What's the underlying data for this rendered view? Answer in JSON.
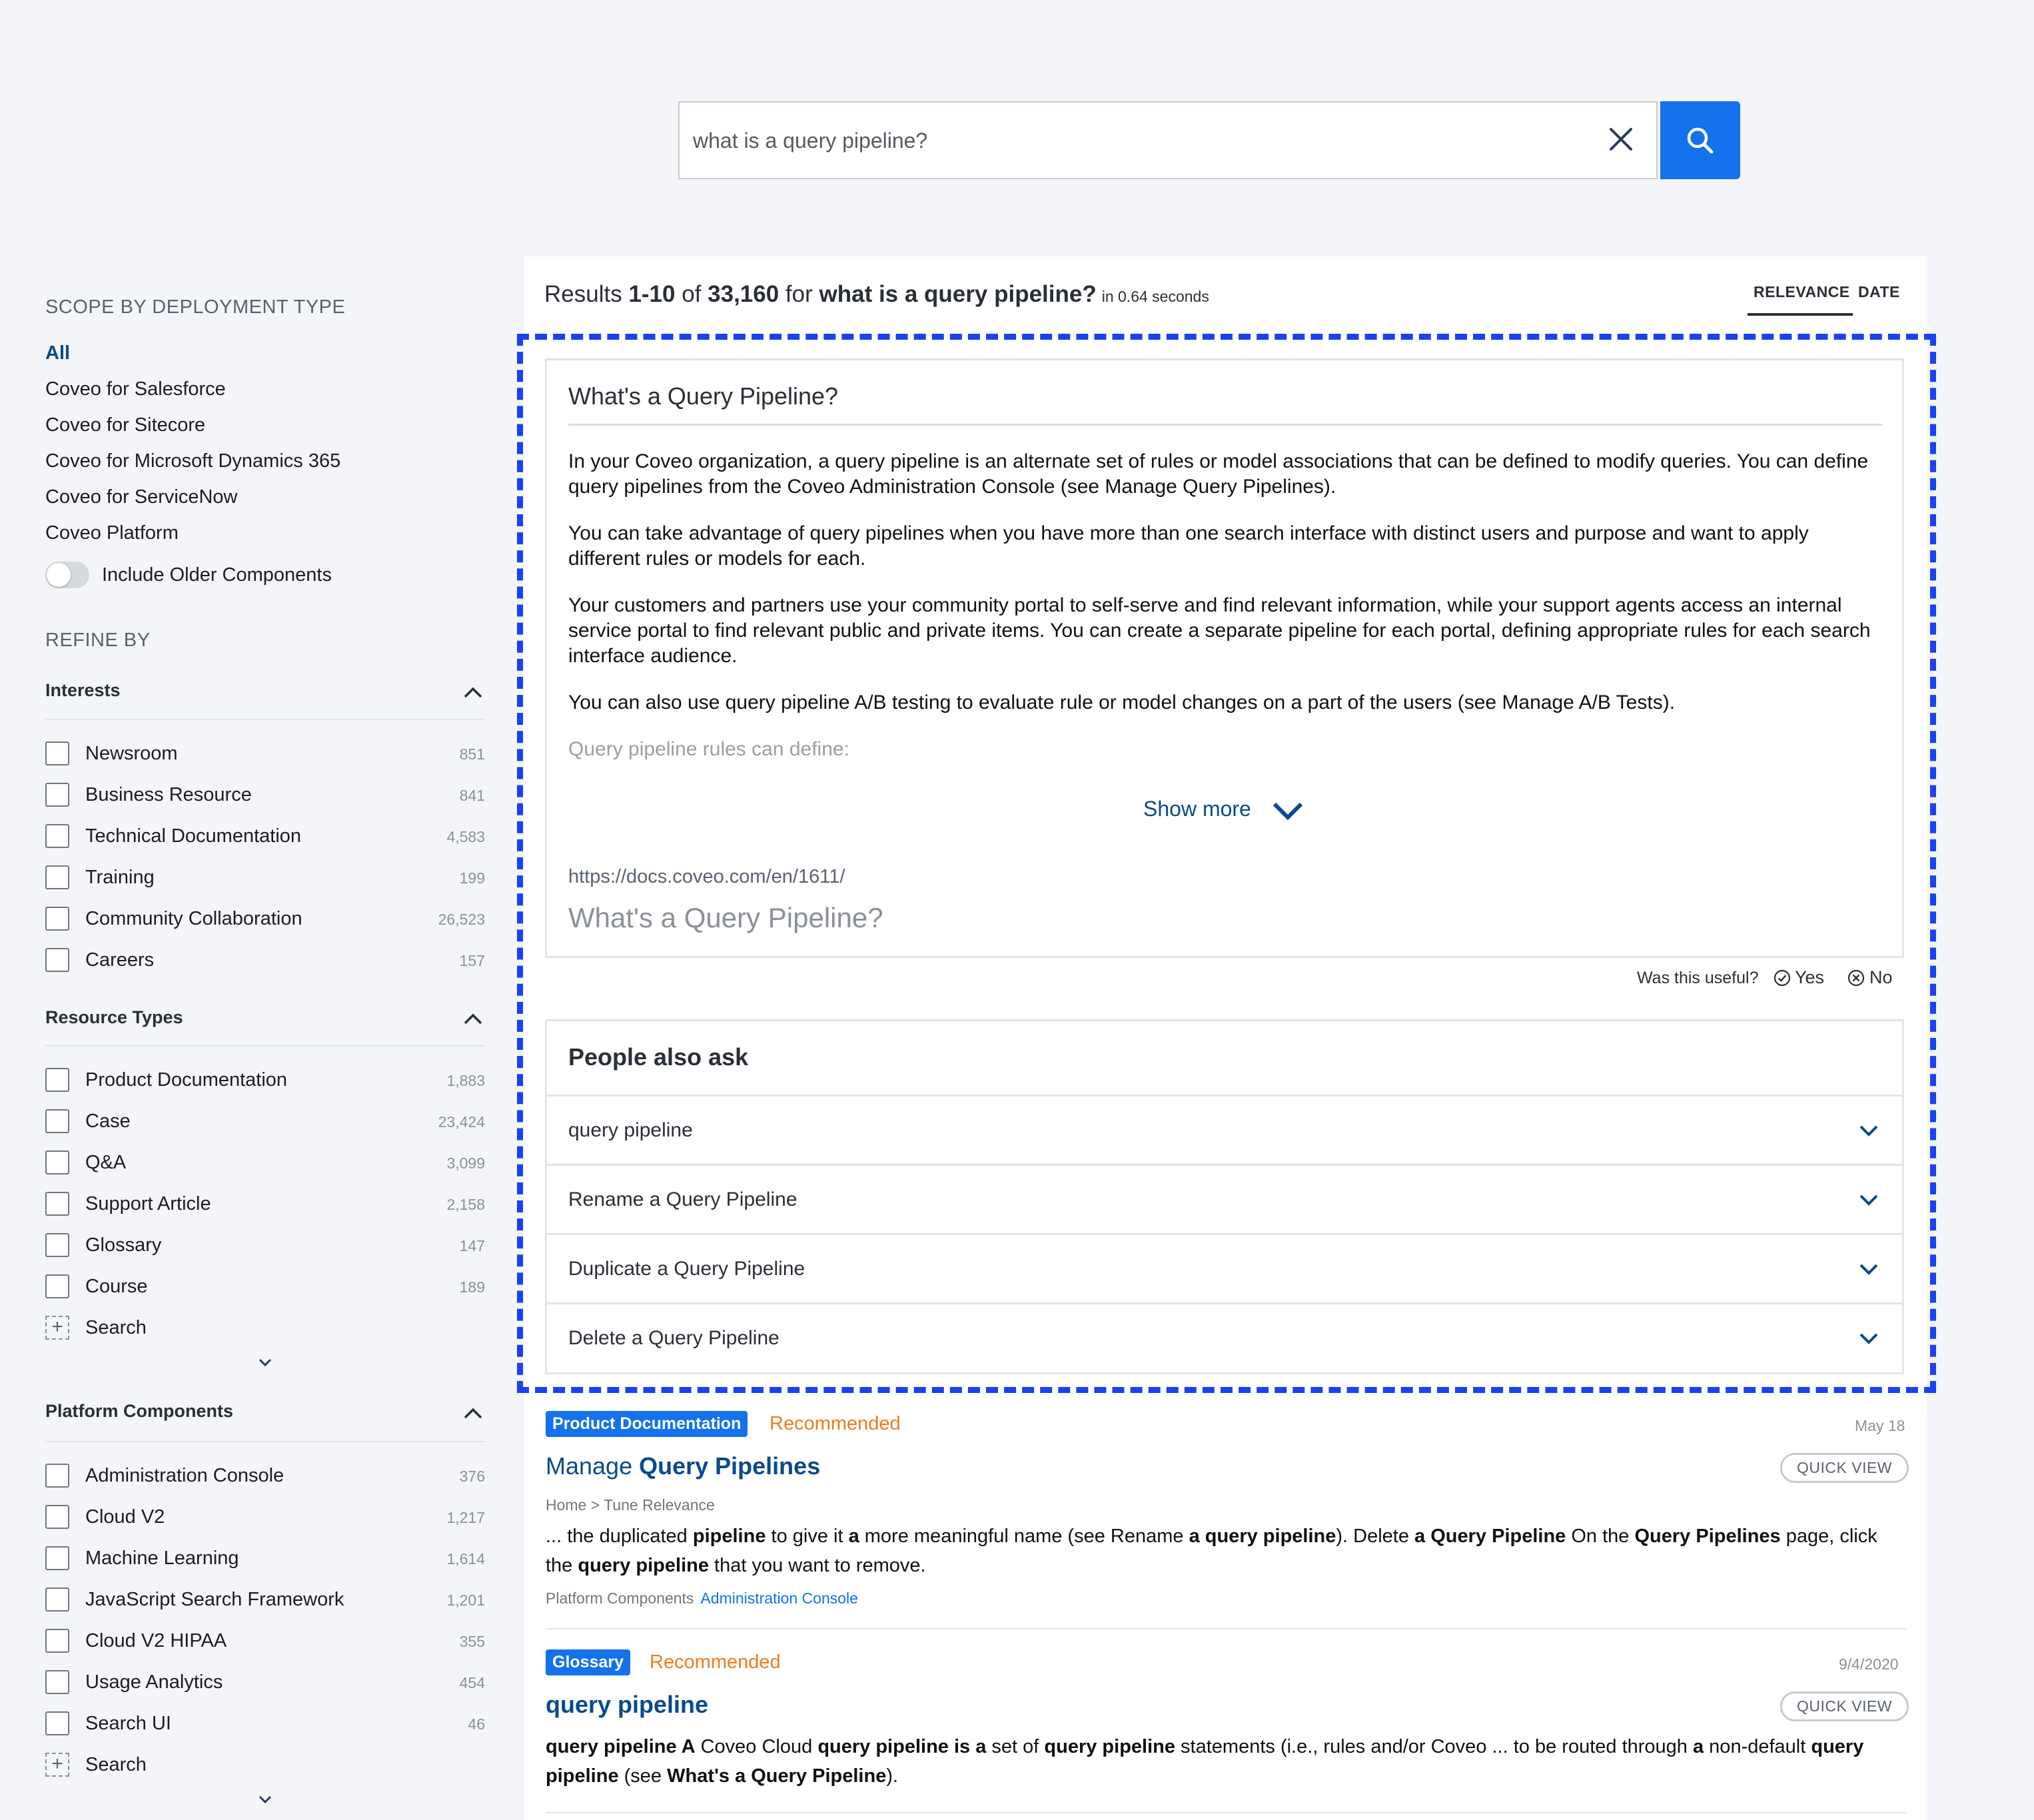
{
  "search": {
    "value": "what is a query pipeline?",
    "placeholder": ""
  },
  "sidebar": {
    "scope_title": "SCOPE BY DEPLOYMENT TYPE",
    "scope_items": [
      "All",
      "Coveo for Salesforce",
      "Coveo for Sitecore",
      "Coveo for Microsoft Dynamics 365",
      "Coveo for ServiceNow",
      "Coveo Platform"
    ],
    "toggle_label": "Include Older Components",
    "refine_title": "REFINE BY",
    "facets": [
      {
        "title": "Interests",
        "values": [
          {
            "label": "Newsroom",
            "count": "851"
          },
          {
            "label": "Business Resource",
            "count": "841"
          },
          {
            "label": "Technical Documentation",
            "count": "4,583"
          },
          {
            "label": "Training",
            "count": "199"
          },
          {
            "label": "Community Collaboration",
            "count": "26,523"
          },
          {
            "label": "Careers",
            "count": "157"
          }
        ]
      },
      {
        "title": "Resource Types",
        "values": [
          {
            "label": "Product Documentation",
            "count": "1,883"
          },
          {
            "label": "Case",
            "count": "23,424"
          },
          {
            "label": "Q&A",
            "count": "3,099"
          },
          {
            "label": "Support Article",
            "count": "2,158"
          },
          {
            "label": "Glossary",
            "count": "147"
          },
          {
            "label": "Course",
            "count": "189"
          }
        ],
        "search_label": "Search"
      },
      {
        "title": "Platform Components",
        "values": [
          {
            "label": "Administration Console",
            "count": "376"
          },
          {
            "label": "Cloud V2",
            "count": "1,217"
          },
          {
            "label": "Machine Learning",
            "count": "1,614"
          },
          {
            "label": "JavaScript Search Framework",
            "count": "1,201"
          },
          {
            "label": "Cloud V2 HIPAA",
            "count": "355"
          },
          {
            "label": "Usage Analytics",
            "count": "454"
          },
          {
            "label": "Search UI",
            "count": "46"
          }
        ],
        "search_label": "Search"
      }
    ]
  },
  "summary": {
    "prefix": "Results ",
    "range": "1-10",
    "of": " of ",
    "total": "33,160",
    "for": " for ",
    "query": "what is a query pipeline?",
    "duration": "in 0.64 seconds"
  },
  "sort": {
    "relevance": "RELEVANCE",
    "date": "DATE"
  },
  "snippet": {
    "question": "What's a Query Pipeline?",
    "paragraphs": [
      "In your Coveo organization, a query pipeline is an alternate set of rules or model associations that can be defined to modify queries. You can define query pipelines from the Coveo Administration Console (see Manage Query Pipelines).",
      "You can take advantage of query pipelines when you have more than one search interface with distinct users and purpose and want to apply different rules or models for each.",
      "Your customers and partners use your community portal to self-serve and find relevant information, while your support agents access an internal service portal to find relevant public and private items. You can create a separate pipeline for each portal, defining appropriate rules for each search interface audience.",
      "You can also use query pipeline A/B testing to evaluate rule or model changes on a part of the users (see Manage A/B Tests).",
      "Query pipeline rules can define:"
    ],
    "show_more": "Show more",
    "source_url": "https://docs.coveo.com/en/1611/",
    "source_title": "What's a Query Pipeline?",
    "feedback_question": "Was this useful?",
    "yes": "Yes",
    "no": "No"
  },
  "people_also_ask": {
    "title": "People also ask",
    "questions": [
      "query pipeline",
      "Rename a Query Pipeline",
      "Duplicate a Query Pipeline",
      "Delete a Query Pipeline"
    ]
  },
  "results": [
    {
      "badge": "Product Documentation",
      "recommended": "Recommended",
      "date": "May 18",
      "title_plain": "Manage ",
      "title_bold": "Query Pipelines",
      "quick_view": "QUICK VIEW",
      "breadcrumb": "Home > Tune Relevance",
      "excerpt": [
        {
          "t": "... the duplicated ",
          "b": false
        },
        {
          "t": "pipeline",
          "b": true
        },
        {
          "t": " to give it ",
          "b": false
        },
        {
          "t": "a",
          "b": true
        },
        {
          "t": " more meaningful name (see Rename ",
          "b": false
        },
        {
          "t": "a query pipeline",
          "b": true
        },
        {
          "t": "). Delete ",
          "b": false
        },
        {
          "t": "a Query Pipeline",
          "b": true
        },
        {
          "t": " On the ",
          "b": false
        },
        {
          "t": "Query Pipelines",
          "b": true
        },
        {
          "t": " page, click the ",
          "b": false
        },
        {
          "t": "query pipeline",
          "b": true
        },
        {
          "t": " that you want to remove.",
          "b": false
        }
      ],
      "field_label": "Platform Components",
      "field_value": "Administration Console"
    },
    {
      "badge": "Glossary",
      "recommended": "Recommended",
      "date": "9/4/2020",
      "title_plain": "",
      "title_bold": "query pipeline",
      "quick_view": "QUICK VIEW",
      "excerpt": [
        {
          "t": "query pipeline A",
          "b": true
        },
        {
          "t": " Coveo Cloud ",
          "b": false
        },
        {
          "t": "query pipeline is a",
          "b": true
        },
        {
          "t": " set of ",
          "b": false
        },
        {
          "t": "query pipeline",
          "b": true
        },
        {
          "t": " statements (i.e., rules and/or Coveo ... to be routed through ",
          "b": false
        },
        {
          "t": "a",
          "b": true
        },
        {
          "t": " non-default ",
          "b": false
        },
        {
          "t": "query pipeline",
          "b": true
        },
        {
          "t": " (see ",
          "b": false
        },
        {
          "t": "What's a Query Pipeline",
          "b": true
        },
        {
          "t": ").",
          "b": false
        }
      ]
    }
  ],
  "colors": {
    "accent": "#1372ec",
    "link": "#0a4a8c",
    "recommended": "#ee7b1c",
    "highlight_border": "#1b41f0"
  }
}
